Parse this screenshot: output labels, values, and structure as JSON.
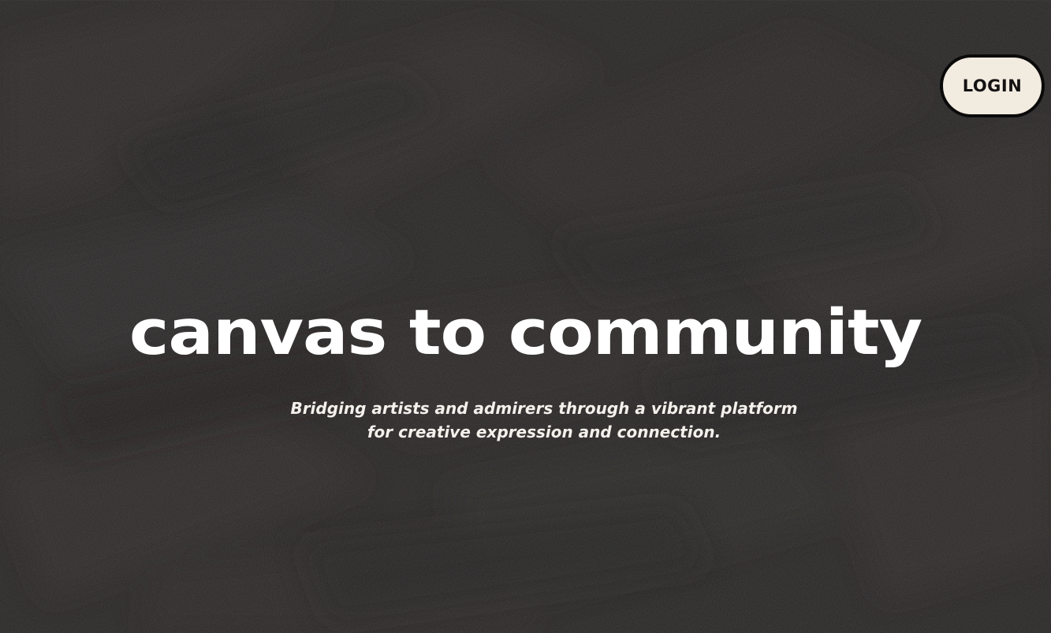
{
  "header": {
    "login_label": "LOGIN"
  },
  "hero": {
    "title": "canvas to community",
    "subtitle_line1": "Bridging artists and admirers through a vibrant platform",
    "subtitle_line2": "for creative expression and connection."
  },
  "colors": {
    "background": "#242222",
    "text": "#ffffff",
    "button_fill": "#f1ebe0",
    "button_border": "#0b0a0a"
  }
}
